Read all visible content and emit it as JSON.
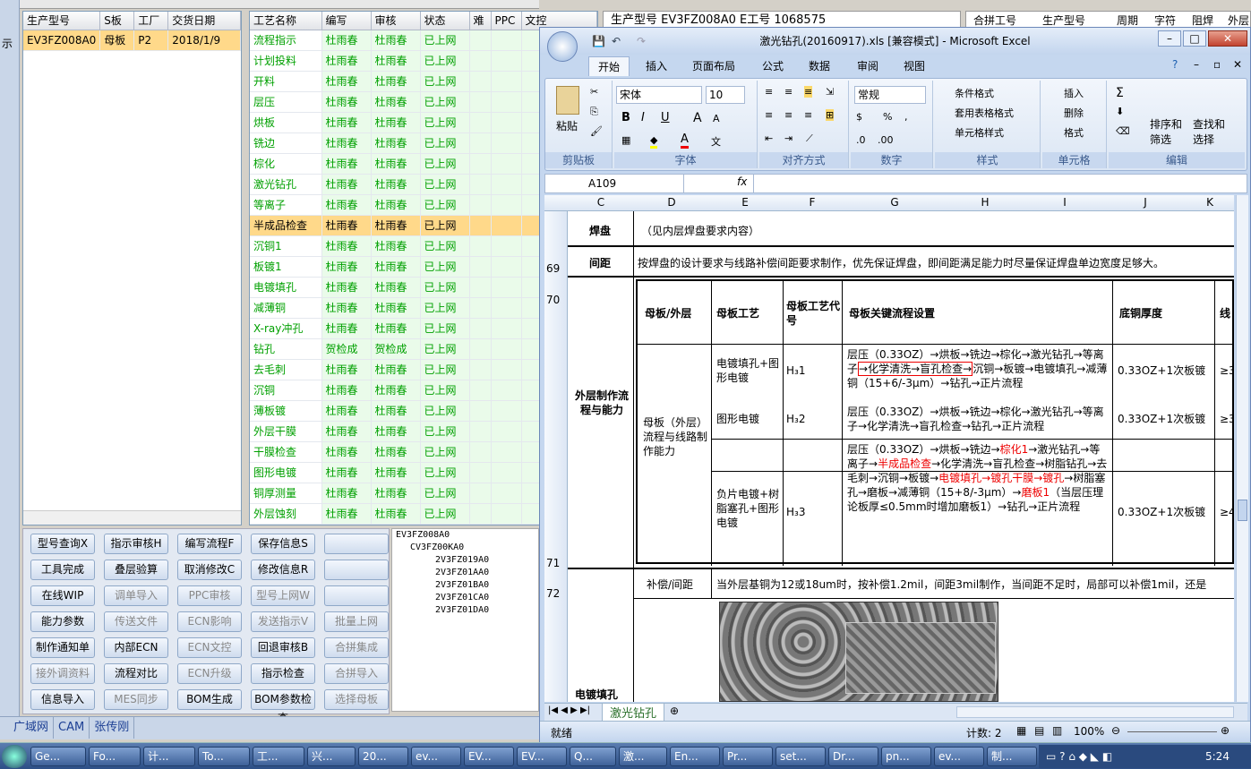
{
  "left_strip": {
    "label": "示"
  },
  "order_grid": {
    "headers": [
      "生产型号",
      "S板",
      "工厂",
      "交货日期"
    ],
    "rows": [
      [
        "EV3FZ008A0",
        "母板",
        "P2",
        "2018/1/9"
      ]
    ]
  },
  "process_grid": {
    "headers": [
      "工艺名称",
      "编写",
      "审核",
      "状态",
      "难",
      "PPC",
      "文控"
    ],
    "rows": [
      [
        "流程指示",
        "杜雨春",
        "杜雨春",
        "已上网"
      ],
      [
        "计划投料",
        "杜雨春",
        "杜雨春",
        "已上网"
      ],
      [
        "开料",
        "杜雨春",
        "杜雨春",
        "已上网"
      ],
      [
        "层压",
        "杜雨春",
        "杜雨春",
        "已上网"
      ],
      [
        "烘板",
        "杜雨春",
        "杜雨春",
        "已上网"
      ],
      [
        "铣边",
        "杜雨春",
        "杜雨春",
        "已上网"
      ],
      [
        "棕化",
        "杜雨春",
        "杜雨春",
        "已上网"
      ],
      [
        "激光钻孔",
        "杜雨春",
        "杜雨春",
        "已上网"
      ],
      [
        "等离子",
        "杜雨春",
        "杜雨春",
        "已上网"
      ],
      [
        "半成品检查",
        "杜雨春",
        "杜雨春",
        "已上网"
      ],
      [
        "沉铜1",
        "杜雨春",
        "杜雨春",
        "已上网"
      ],
      [
        "板镀1",
        "杜雨春",
        "杜雨春",
        "已上网"
      ],
      [
        "电镀填孔",
        "杜雨春",
        "杜雨春",
        "已上网"
      ],
      [
        "减薄铜",
        "杜雨春",
        "杜雨春",
        "已上网"
      ],
      [
        "X-ray冲孔",
        "杜雨春",
        "杜雨春",
        "已上网"
      ],
      [
        "钻孔",
        "贺检成",
        "贺检成",
        "已上网"
      ],
      [
        "去毛刺",
        "杜雨春",
        "杜雨春",
        "已上网"
      ],
      [
        "沉铜",
        "杜雨春",
        "杜雨春",
        "已上网"
      ],
      [
        "薄板镀",
        "杜雨春",
        "杜雨春",
        "已上网"
      ],
      [
        "外层干膜",
        "杜雨春",
        "杜雨春",
        "已上网"
      ],
      [
        "干膜检查",
        "杜雨春",
        "杜雨春",
        "已上网"
      ],
      [
        "图形电镀",
        "杜雨春",
        "杜雨春",
        "已上网"
      ],
      [
        "铜厚测量",
        "杜雨春",
        "杜雨春",
        "已上网"
      ],
      [
        "外层蚀刻",
        "杜雨春",
        "杜雨春",
        "已上网"
      ]
    ],
    "selected_index": 9
  },
  "buttons": [
    [
      "型号查询X",
      "指示审核H",
      "编写流程F",
      "保存信息S",
      ""
    ],
    [
      "工具完成",
      "叠层验算",
      "取消修改C",
      "修改信息R",
      ""
    ],
    [
      "在线WIP",
      "调单导入",
      "PPC审核",
      "型号上网W",
      ""
    ],
    [
      "能力参数",
      "传送文件",
      "ECN影响",
      "发送指示V",
      "批量上网"
    ],
    [
      "制作通知单",
      "内部ECN",
      "ECN文控",
      "回退审核B",
      "合拼集成"
    ],
    [
      "接外调资料",
      "流程对比",
      "ECN升级",
      "指示检查",
      "合拼导入"
    ],
    [
      "信息导入",
      "MES同步",
      "BOM生成",
      "BOM参数检查",
      "选择母板"
    ]
  ],
  "disabled_buttons": [
    "调单导入",
    "PPC审核",
    "传送文件",
    "ECN影响",
    "批量上网",
    "ECN文控",
    "合拼集成",
    "接外调资料",
    "ECN升级",
    "合拼导入",
    "MES同步",
    "选择母板",
    "型号上网W",
    "发送指示V"
  ],
  "tree": [
    "EV3FZ008A0",
    "CV3FZ00KA0",
    "2V3FZ019A0",
    "2V3FZ01AA0",
    "2V3FZ01BA0",
    "2V3FZ01CA0",
    "2V3FZ01DA0"
  ],
  "bottom_tabs": [
    "广域网",
    "CAM",
    "张传刚"
  ],
  "right_header": {
    "a": "生产型号  EV3FZ008A0      E工号  1068575",
    "b": [
      "合拼工号",
      "生产型号",
      "周期",
      "字符",
      "阻焊",
      "外层"
    ]
  },
  "excel": {
    "title": "激光钻孔(20160917).xls  [兼容模式] - Microsoft Excel",
    "tabs": [
      "开始",
      "插入",
      "页面布局",
      "公式",
      "数据",
      "审阅",
      "视图"
    ],
    "groups": [
      "剪贴板",
      "字体",
      "对齐方式",
      "数字",
      "样式",
      "单元格",
      "编辑"
    ],
    "font_name": "宋体",
    "font_size": "10",
    "number_format": "常规",
    "buttons": {
      "paste": "粘贴",
      "cond_fmt": "条件格式",
      "table_fmt": "套用表格格式",
      "cell_style": "单元格样式",
      "insert": "插入",
      "delete": "删除",
      "format": "格式",
      "sort": "排序和\n筛选",
      "find": "查找和\n选择"
    },
    "namebox": "A109",
    "fx": "fx",
    "columns": [
      "C",
      "D",
      "E",
      "F",
      "G",
      "H",
      "I",
      "J",
      "K"
    ],
    "rows": {
      "r69": "69",
      "r70": "70",
      "r71": "71",
      "r72": "72"
    },
    "c69": "焊盘",
    "d69": "（见内层焊盘要求内容）",
    "c70": "间距",
    "d70": "按焊盘的设计要求与线路补偿间距要求制作，优先保证焊盘，即间距满足能力时尽量保证焊盘单边宽度足够大。",
    "c71": "外层制作流程与能力",
    "t_head": [
      "母板/外层",
      "母板工艺",
      "母板工艺代号",
      "母板关键流程设置",
      "底铜厚度",
      "线"
    ],
    "t_d": "母板（外层）流程与线路制作能力",
    "t_r1": [
      "电镀填孔+图形电镀",
      "H₃1",
      "层压（0.33OZ）→烘板→铣边→棕化→激光钻孔→等离子",
      "→化学清洗→盲孔检查→",
      "沉铜→板镀→电镀填孔→减薄铜（15+6/-3μm）→钻孔→正片流程",
      "0.33OZ+1次板镀",
      "≥3"
    ],
    "t_r2": [
      "图形电镀",
      "H₃2",
      "层压（0.33OZ）→烘板→铣边→棕化→激光钻孔→等离子→化学清洗→盲孔检查→钻孔→正片流程",
      "0.33OZ+1次板镀",
      "≥3"
    ],
    "t_r3": [
      "负片电镀+树脂塞孔+图形电镀",
      "H₃3",
      "层压（0.33OZ）→烘板→铣边→",
      "棕化1",
      "→激光钻孔→等离子→",
      "半成品检查",
      "→化学清洗→盲孔检查→树脂钻孔→去毛刺→沉铜→板镀→",
      "电镀填孔→镀孔干膜→镀孔",
      "→树脂塞孔→磨板→减薄铜（15+8/-3μm）→",
      "磨板1",
      "（当层压理论板厚≤0.5mm时增加磨板1）→钻孔→正片流程",
      "0.33OZ+1次板镀",
      "≥4"
    ],
    "d72": "补偿/间距",
    "e72": "当外层基铜为12或18um时，按补偿1.2mil，间距3mil制作，当间距不足时，局部可以补偿1mil，还是",
    "c_bottom": "电镀填孔",
    "sheet_tab": "激光钻孔",
    "status_left": "就绪",
    "count": "计数: 2",
    "zoom": "100%"
  },
  "taskbar": [
    "Ge...",
    "Fo...",
    "计...",
    "To...",
    "工...",
    "兴...",
    "20...",
    "ev...",
    "EV...",
    "EV...",
    "Q...",
    "激...",
    "En...",
    "Pr...",
    "set...",
    "Dr...",
    "pn...",
    "ev...",
    "制..."
  ],
  "clock": "5:24"
}
